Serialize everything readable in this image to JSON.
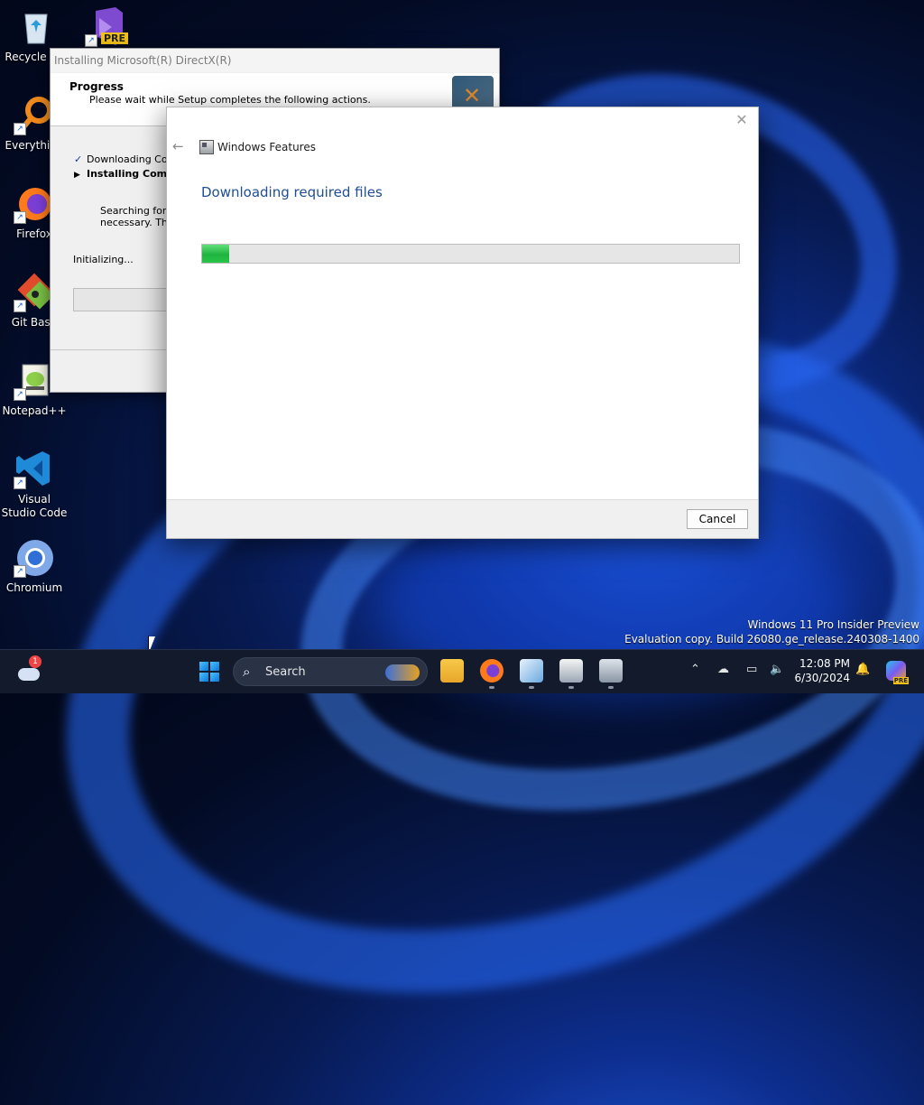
{
  "desktop": {
    "icons": [
      {
        "label": "Recycle Bin"
      },
      {
        "label": "PRE"
      },
      {
        "label": "Everything"
      },
      {
        "label": "Firefox"
      },
      {
        "label": "Git Bash"
      },
      {
        "label": "Notepad++"
      },
      {
        "label": "Visual Studio Code"
      },
      {
        "label": "Chromium"
      }
    ]
  },
  "directx": {
    "title": "Installing Microsoft(R) DirectX(R)",
    "heading": "Progress",
    "subheading": "Please wait while Setup completes the following actions.",
    "step1": "Downloading Components",
    "step2": "Installing Components",
    "search_line1": "Searching for updates and installing components as",
    "search_line2": "necessary. This may take a few minutes.",
    "status": "Initializing..."
  },
  "features": {
    "title": "Windows Features",
    "heading": "Downloading required files",
    "progress": 0.05,
    "cancel": "Cancel"
  },
  "watermark": {
    "line1": "Windows 11 Pro Insider Preview",
    "line2": "Evaluation copy. Build 26080.ge_release.240308-1400"
  },
  "taskbar": {
    "weather_badge": "1",
    "search_label": "Search",
    "time": "12:08 PM",
    "date": "6/30/2024",
    "copilot_badge": "PRE"
  }
}
